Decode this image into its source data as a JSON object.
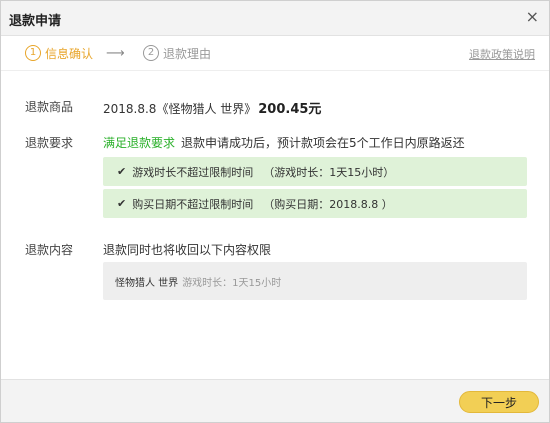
{
  "dialog": {
    "title": "退款申请",
    "close_glyph": "×"
  },
  "steps": [
    {
      "number": "1",
      "label": "信息确认",
      "state": "active",
      "color": "#e8a52a"
    },
    {
      "number": "2",
      "label": "退款理由",
      "state": "inactive",
      "color": "#999999"
    }
  ],
  "step_arrow": "⟶",
  "policy_link": "退款政策说明",
  "product": {
    "label": "退款商品",
    "value": "2018.8.8《怪物猎人 世界》",
    "price": "200.45元"
  },
  "requirements": {
    "label": "退款要求",
    "status": "满足退款要求",
    "status_color": "#2ab02a",
    "note": "退款申请成功后，预计款项会在5个工作日内原路返还",
    "checks": [
      {
        "icon": "check-icon",
        "glyph": "✔",
        "text": "游戏时长不超过限制时间",
        "detail": "（游戏时长：1天15小时）"
      },
      {
        "icon": "check-icon",
        "glyph": "✔",
        "text": "购买日期不超过限制时间",
        "detail": "（购买日期：2018.8.8 ）"
      }
    ],
    "check_bg": "#dff2d8"
  },
  "content": {
    "label": "退款内容",
    "description": "退款同时也将收回以下内容权限",
    "game": "怪物猎人 世界",
    "duration": "游戏时长：1天15小时"
  },
  "footer": {
    "next_label": "下一步",
    "next_color": "#f2cf55"
  }
}
